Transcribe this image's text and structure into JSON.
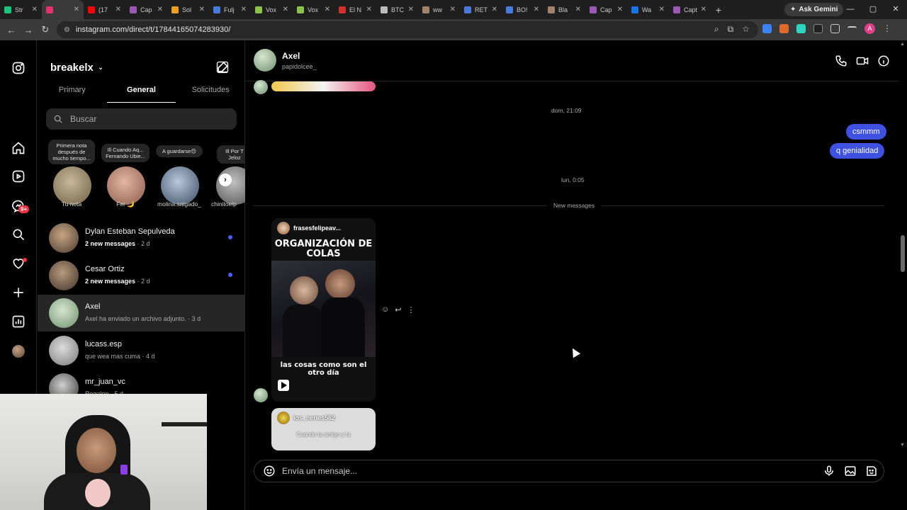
{
  "browser": {
    "tabs": [
      {
        "title": "Str",
        "color": "#19c37d"
      },
      {
        "title": "",
        "color": "#e1306c",
        "active": true
      },
      {
        "title": "(17",
        "color": "#ff0000"
      },
      {
        "title": "Cap",
        "color": "#9b59b6"
      },
      {
        "title": "Sol",
        "color": "#f0a020"
      },
      {
        "title": "Fulj",
        "color": "#4a7bdc"
      },
      {
        "title": "Vox",
        "color": "#8bc34a"
      },
      {
        "title": "Vox",
        "color": "#8bc34a"
      },
      {
        "title": "El N",
        "color": "#d32f2f"
      },
      {
        "title": "BTC",
        "color": "#bbbbbb"
      },
      {
        "title": "ww",
        "color": "#a0826d"
      },
      {
        "title": "RET",
        "color": "#4a7bdc"
      },
      {
        "title": "BO!",
        "color": "#4a7bdc"
      },
      {
        "title": "Bla",
        "color": "#a0826d"
      },
      {
        "title": "Cap",
        "color": "#9b59b6"
      },
      {
        "title": "Wa",
        "color": "#1a73e8"
      },
      {
        "title": "Captura",
        "color": "#9b59b6"
      }
    ],
    "new_tab": "+",
    "ask_gemini": "Ask Gemini",
    "url": "instagram.com/direct/t/17844165074283930/",
    "profile_initial": "A"
  },
  "rail": {
    "notifications_badge": "9+"
  },
  "inbox": {
    "account": "breakelx",
    "tabs": [
      "Primary",
      "General",
      "Solicitudes"
    ],
    "active_tab": 1,
    "search_placeholder": "Buscar",
    "notes": [
      {
        "note": "Primera nota después de mucho tiempo...",
        "name": "Tu nota",
        "color": "#a9a186"
      },
      {
        "note": "Ill Cuando Aq... Fernando Ubie...",
        "name": "Fer 🌙",
        "color": "#c98f7a"
      },
      {
        "note": "A guardarse😔",
        "name": "molina.salgado_",
        "color": "#7d8fa8"
      },
      {
        "note": "Ill Por T Jeloz",
        "name": "chinitoelp",
        "color": "#a0a0a0"
      }
    ],
    "threads": [
      {
        "name": "Dylan Esteban Sepulveda",
        "sub": "2 new messages",
        "time": " · 2 d",
        "unread": true,
        "color": "#8b6f58"
      },
      {
        "name": "Cesar Ortiz",
        "sub": "2 new messages",
        "time": " · 2 d",
        "unread": true,
        "color": "#6d5a48"
      },
      {
        "name": "Axel",
        "sub": "Axel ha enviado un archivo adjunto.",
        "time": " · 3 d",
        "unread": false,
        "selected": true,
        "color": "#8fae8a"
      },
      {
        "name": "lucass.esp",
        "sub": "que wea mas cuma",
        "time": " · 4 d",
        "unread": false,
        "color": "#b0b0b0"
      },
      {
        "name": "mr_juan_vc",
        "sub": "Regalon",
        "time": " · 5 d",
        "unread": false,
        "color": "#5a5a5a"
      }
    ]
  },
  "chat": {
    "name": "Axel",
    "username": "papidolcee_",
    "time1": "dom, 21:09",
    "out_messages": [
      "csmmm",
      "q genialidad"
    ],
    "time2": "lun, 0:05",
    "new_messages_label": "New messages",
    "reel1": {
      "author": "frasesfelipeav...",
      "title": "ORGANIZACIÓN DE COLAS",
      "caption": "las cosas como son el otro día"
    },
    "reel2": {
      "author": "los_nenes562",
      "caption": "Cuando tu amigo y tu"
    },
    "composer_placeholder": "Envía un mensaje..."
  }
}
